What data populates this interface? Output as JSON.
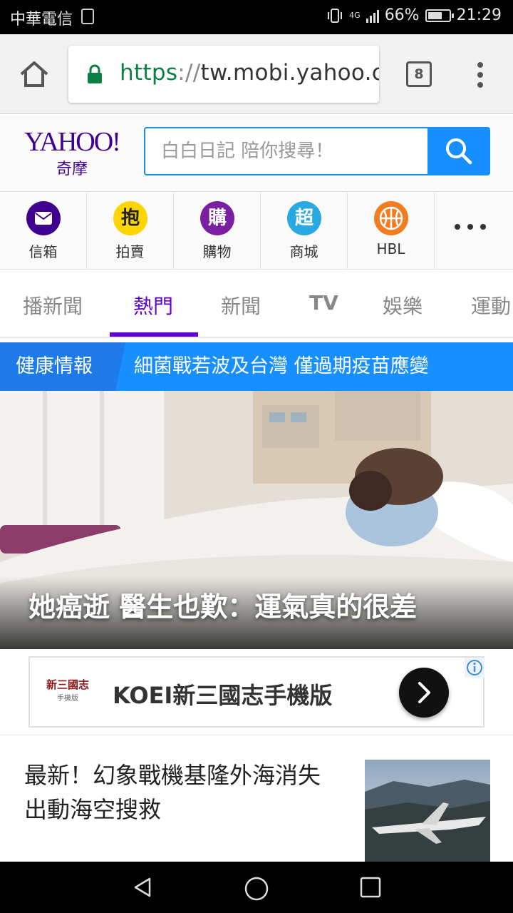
{
  "status_bar": {
    "carrier": "中華電信",
    "network": "4G",
    "battery": "66%",
    "time": "21:29"
  },
  "browser": {
    "url_scheme": "https",
    "url_sep": "://",
    "url_host": "tw.mobi.yahoo.cc",
    "tab_count": "8",
    "icons": [
      "home-icon",
      "lock-icon",
      "tabs-icon",
      "overflow-menu-icon"
    ]
  },
  "header": {
    "logo_word": "YAHOO!",
    "logo_chinese": "奇摩",
    "search_placeholder": "白白日記 陪你搜尋！"
  },
  "apps": [
    {
      "label": "信箱",
      "icon": "mail-icon",
      "color": "#400090",
      "glyph": ""
    },
    {
      "label": "拍賣",
      "icon": "auction-icon",
      "color": "#ffd500",
      "glyph": "抱"
    },
    {
      "label": "購物",
      "icon": "shopping-icon",
      "color": "#7b1fa2",
      "glyph": "購"
    },
    {
      "label": "商城",
      "icon": "mall-icon",
      "color": "#29a9e1",
      "glyph": "超"
    },
    {
      "label": "HBL",
      "icon": "basketball-icon",
      "color": "#f47c20",
      "glyph": ""
    }
  ],
  "categories": [
    {
      "label": "播新聞",
      "active": false
    },
    {
      "label": "熱門",
      "active": true
    },
    {
      "label": "新聞",
      "active": false
    },
    {
      "label": "TV",
      "active": false
    },
    {
      "label": "娛樂",
      "active": false
    },
    {
      "label": "運動",
      "active": false
    }
  ],
  "topic": {
    "tag": "健康情報",
    "headline": "細菌戰若波及台灣 僅過期疫苗應變"
  },
  "hero": {
    "caption": "她癌逝 醫生也歎：運氣真的很差"
  },
  "ad": {
    "title": "KOEI新三國志手機版",
    "logo_text": "新三國志",
    "logo_subtext": "手機版"
  },
  "news": {
    "title": "最新！幻象戰機基隆外海消失 出動海空搜救"
  },
  "colors": {
    "yahoo_purple": "#6001d2",
    "search_blue": "#188fff",
    "secure_green": "#0b8043"
  }
}
